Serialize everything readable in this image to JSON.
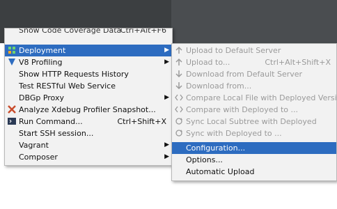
{
  "main_menu": {
    "partial_top": {
      "label": "Show Code Coverage Data",
      "shortcut": "Ctrl+Alt+F6"
    },
    "items": [
      {
        "label": "Deployment",
        "shortcut": "",
        "has_submenu": true,
        "selected": true,
        "icon": "deployment-icon"
      },
      {
        "label": "V8 Profiling",
        "shortcut": "",
        "has_submenu": true,
        "icon": "v8-icon"
      },
      {
        "label": "Show HTTP Requests History",
        "shortcut": "",
        "has_submenu": false
      },
      {
        "label": "Test RESTful Web Service",
        "shortcut": "",
        "has_submenu": false
      },
      {
        "label": "DBGp Proxy",
        "shortcut": "",
        "has_submenu": true
      },
      {
        "label": "Analyze Xdebug Profiler Snapshot...",
        "shortcut": "",
        "has_submenu": false,
        "icon": "xdebug-icon"
      },
      {
        "label": "Run Command...",
        "shortcut": "Ctrl+Shift+X",
        "has_submenu": false,
        "icon": "terminal-icon"
      },
      {
        "label": "Start SSH session...",
        "shortcut": "",
        "has_submenu": false
      },
      {
        "label": "Vagrant",
        "shortcut": "",
        "has_submenu": true
      },
      {
        "label": "Composer",
        "shortcut": "",
        "has_submenu": true
      }
    ]
  },
  "deployment_submenu": {
    "items": [
      {
        "label": "Upload to Default Server",
        "shortcut": "",
        "disabled": true,
        "icon": "upload-icon"
      },
      {
        "label": "Upload to...",
        "shortcut": "Ctrl+Alt+Shift+X",
        "disabled": true,
        "icon": "upload-icon"
      },
      {
        "label": "Download from Default Server",
        "shortcut": "",
        "disabled": true,
        "icon": "download-icon"
      },
      {
        "label": "Download from...",
        "shortcut": "",
        "disabled": true,
        "icon": "download-icon"
      },
      {
        "label": "Compare Local File with Deployed Version",
        "shortcut": "",
        "disabled": true,
        "icon": "compare-icon"
      },
      {
        "label": "Compare with Deployed to ...",
        "shortcut": "",
        "disabled": true,
        "icon": "compare-icon"
      },
      {
        "label": "Sync Local Subtree with Deployed",
        "shortcut": "",
        "disabled": true,
        "icon": "sync-icon"
      },
      {
        "label": "Sync with Deployed to ...",
        "shortcut": "",
        "disabled": true,
        "icon": "sync-icon"
      },
      {
        "label": "Configuration...",
        "shortcut": "",
        "disabled": false,
        "selected": true
      },
      {
        "label": "Options...",
        "shortcut": "",
        "disabled": false
      },
      {
        "label": "Automatic Upload",
        "shortcut": "",
        "disabled": false
      }
    ]
  },
  "colors": {
    "selection": "#2d6cc0",
    "menu_bg": "#f2f2f2",
    "disabled_text": "#9a9a9a",
    "ide_bg": "#3c3f41"
  }
}
